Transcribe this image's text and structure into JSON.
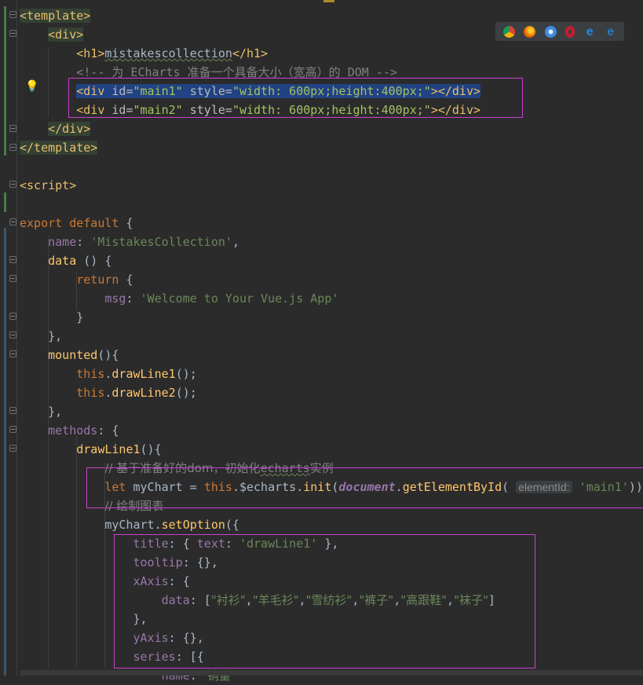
{
  "editor": {
    "lines": [
      {
        "segs": [
          {
            "t": "<template>",
            "c": "tag tag-bg"
          }
        ]
      },
      {
        "segs": [
          {
            "t": "    "
          },
          {
            "t": "<div>",
            "c": "tag tag-bg"
          }
        ]
      },
      {
        "segs": [
          {
            "t": "        "
          },
          {
            "t": "<h1>",
            "c": "tag"
          },
          {
            "t": "mistakescollection",
            "c": "squig"
          },
          {
            "t": "</h1>",
            "c": "tag"
          }
        ]
      },
      {
        "segs": [
          {
            "t": "        "
          },
          {
            "t": "<!-- 为 ECharts 准备一个具备大小（宽高）的 DOM -->",
            "c": "com"
          }
        ]
      },
      {
        "segs": [
          {
            "t": "        "
          },
          {
            "t": "<div ",
            "c": "tag sel"
          },
          {
            "t": "id=",
            "c": "attr sel"
          },
          {
            "t": "\"main1\"",
            "c": "val sel"
          },
          {
            "t": " style=",
            "c": "attr sel"
          },
          {
            "t": "\"width: 600px;height:400px;\"",
            "c": "val sel"
          },
          {
            "t": "></div>",
            "c": "tag sel"
          }
        ]
      },
      {
        "segs": [
          {
            "t": "        "
          },
          {
            "t": "<div ",
            "c": "tag"
          },
          {
            "t": "id=",
            "c": "attr"
          },
          {
            "t": "\"main2\"",
            "c": "val"
          },
          {
            "t": " style=",
            "c": "attr"
          },
          {
            "t": "\"width: 600px;height:400px;\"",
            "c": "val"
          },
          {
            "t": "></div>",
            "c": "tag"
          }
        ]
      },
      {
        "segs": [
          {
            "t": "    "
          },
          {
            "t": "</div>",
            "c": "tag tag-bg"
          }
        ]
      },
      {
        "segs": [
          {
            "t": "</template>",
            "c": "tag tag-bg"
          }
        ]
      },
      {
        "segs": []
      },
      {
        "segs": [
          {
            "t": "<script>",
            "c": "tag"
          }
        ]
      },
      {
        "segs": []
      },
      {
        "segs": [
          {
            "t": "export default",
            "c": "kw"
          },
          {
            "t": " {"
          }
        ]
      },
      {
        "segs": [
          {
            "t": "    "
          },
          {
            "t": "name",
            "c": "prop"
          },
          {
            "t": ": "
          },
          {
            "t": "'MistakesCollection'",
            "c": "str"
          },
          {
            "t": ","
          }
        ]
      },
      {
        "segs": [
          {
            "t": "    "
          },
          {
            "t": "data",
            "c": "fn"
          },
          {
            "t": " () {"
          }
        ]
      },
      {
        "segs": [
          {
            "t": "        "
          },
          {
            "t": "return",
            "c": "kw"
          },
          {
            "t": " {"
          }
        ]
      },
      {
        "segs": [
          {
            "t": "            "
          },
          {
            "t": "msg",
            "c": "prop"
          },
          {
            "t": ": "
          },
          {
            "t": "'Welcome to Your Vue.js App'",
            "c": "str"
          }
        ]
      },
      {
        "segs": [
          {
            "t": "        }"
          }
        ]
      },
      {
        "segs": [
          {
            "t": "    },"
          }
        ]
      },
      {
        "segs": [
          {
            "t": "    "
          },
          {
            "t": "mounted",
            "c": "fn"
          },
          {
            "t": "(){"
          }
        ]
      },
      {
        "segs": [
          {
            "t": "        "
          },
          {
            "t": "this",
            "c": "kw"
          },
          {
            "t": "."
          },
          {
            "t": "drawLine1",
            "c": "fn"
          },
          {
            "t": "();"
          }
        ]
      },
      {
        "segs": [
          {
            "t": "        "
          },
          {
            "t": "this",
            "c": "kw"
          },
          {
            "t": "."
          },
          {
            "t": "drawLine2",
            "c": "fn"
          },
          {
            "t": "();"
          }
        ]
      },
      {
        "segs": [
          {
            "t": "    },"
          }
        ]
      },
      {
        "segs": [
          {
            "t": "    "
          },
          {
            "t": "methods",
            "c": "prop"
          },
          {
            "t": ": {"
          }
        ]
      },
      {
        "segs": [
          {
            "t": "        "
          },
          {
            "t": "drawLine1",
            "c": "fn"
          },
          {
            "t": "(){"
          }
        ]
      },
      {
        "segs": [
          {
            "t": "            "
          },
          {
            "t": "// 基于准备好的dom，初始化",
            "c": "com cjk"
          },
          {
            "t": "echarts",
            "c": "com squig"
          },
          {
            "t": "实例",
            "c": "com cjk"
          }
        ]
      },
      {
        "segs": [
          {
            "t": "            "
          },
          {
            "t": "let",
            "c": "kw"
          },
          {
            "t": " myChart = "
          },
          {
            "t": "this",
            "c": "kw"
          },
          {
            "t": ".$echarts."
          },
          {
            "t": "init",
            "c": "fn"
          },
          {
            "t": "("
          },
          {
            "t": "document",
            "c": "glob"
          },
          {
            "t": "."
          },
          {
            "t": "getElementById",
            "c": "fn"
          },
          {
            "t": "( "
          },
          {
            "t": "elementId:",
            "c": "hint"
          },
          {
            "t": " "
          },
          {
            "t": "'main1'",
            "c": "str"
          },
          {
            "t": "))"
          }
        ]
      },
      {
        "segs": [
          {
            "t": "            "
          },
          {
            "t": "// 绘制图表",
            "c": "com cjk"
          }
        ]
      },
      {
        "segs": [
          {
            "t": "            myChart."
          },
          {
            "t": "setOption",
            "c": "fn"
          },
          {
            "t": "({"
          }
        ]
      },
      {
        "segs": [
          {
            "t": "                "
          },
          {
            "t": "title",
            "c": "prop"
          },
          {
            "t": ": { "
          },
          {
            "t": "text",
            "c": "prop"
          },
          {
            "t": ": "
          },
          {
            "t": "'drawLine1'",
            "c": "str"
          },
          {
            "t": " },"
          }
        ]
      },
      {
        "segs": [
          {
            "t": "                "
          },
          {
            "t": "tooltip",
            "c": "prop"
          },
          {
            "t": ": {},"
          }
        ]
      },
      {
        "segs": [
          {
            "t": "                "
          },
          {
            "t": "xAxis",
            "c": "prop"
          },
          {
            "t": ": {"
          }
        ]
      },
      {
        "segs": [
          {
            "t": "                    "
          },
          {
            "t": "data",
            "c": "prop"
          },
          {
            "t": ": ["
          },
          {
            "t": "\"衬衫\"",
            "c": "str cjk"
          },
          {
            "t": ","
          },
          {
            "t": "\"羊毛衫\"",
            "c": "str cjk"
          },
          {
            "t": ","
          },
          {
            "t": "\"雪纺衫\"",
            "c": "str cjk"
          },
          {
            "t": ","
          },
          {
            "t": "\"裤子\"",
            "c": "str cjk"
          },
          {
            "t": ","
          },
          {
            "t": "\"高跟鞋\"",
            "c": "str cjk"
          },
          {
            "t": ","
          },
          {
            "t": "\"袜子\"",
            "c": "str cjk"
          },
          {
            "t": "]"
          }
        ]
      },
      {
        "segs": [
          {
            "t": "                },"
          }
        ]
      },
      {
        "segs": [
          {
            "t": "                "
          },
          {
            "t": "yAxis",
            "c": "prop"
          },
          {
            "t": ": {},"
          }
        ]
      },
      {
        "segs": [
          {
            "t": "                "
          },
          {
            "t": "series",
            "c": "prop"
          },
          {
            "t": ": [{"
          }
        ]
      },
      {
        "segs": [
          {
            "t": "                    "
          },
          {
            "t": "name",
            "c": "prop"
          },
          {
            "t": ": "
          },
          {
            "t": "'销量'",
            "c": "str cjk"
          }
        ]
      }
    ]
  },
  "browser_icons": [
    "chrome-icon",
    "firefox-icon",
    "safari-icon",
    "opera-icon",
    "ie-icon",
    "edge-icon"
  ],
  "colors": {
    "chrome": "#4caf50",
    "firefox": "#e66000",
    "safari": "#3c8de0",
    "opera": "#cc1b2c",
    "ie": "#1e88e5",
    "edge": "#2a7ac2",
    "annotation": "#c93fcf"
  }
}
